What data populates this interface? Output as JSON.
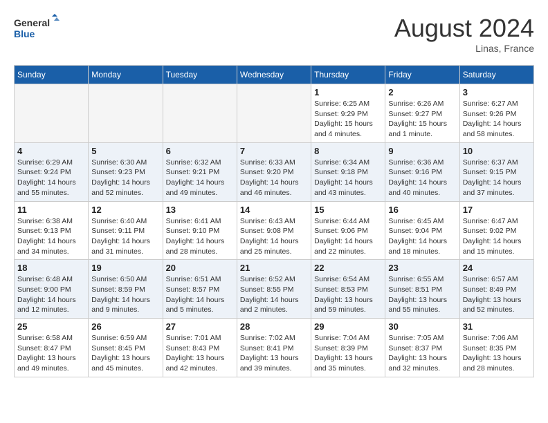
{
  "header": {
    "logo_line1": "General",
    "logo_line2": "Blue",
    "month_year": "August 2024",
    "location": "Linas, France"
  },
  "weekdays": [
    "Sunday",
    "Monday",
    "Tuesday",
    "Wednesday",
    "Thursday",
    "Friday",
    "Saturday"
  ],
  "weeks": [
    [
      {
        "day": "",
        "info": ""
      },
      {
        "day": "",
        "info": ""
      },
      {
        "day": "",
        "info": ""
      },
      {
        "day": "",
        "info": ""
      },
      {
        "day": "1",
        "info": "Sunrise: 6:25 AM\nSunset: 9:29 PM\nDaylight: 15 hours\nand 4 minutes."
      },
      {
        "day": "2",
        "info": "Sunrise: 6:26 AM\nSunset: 9:27 PM\nDaylight: 15 hours\nand 1 minute."
      },
      {
        "day": "3",
        "info": "Sunrise: 6:27 AM\nSunset: 9:26 PM\nDaylight: 14 hours\nand 58 minutes."
      }
    ],
    [
      {
        "day": "4",
        "info": "Sunrise: 6:29 AM\nSunset: 9:24 PM\nDaylight: 14 hours\nand 55 minutes."
      },
      {
        "day": "5",
        "info": "Sunrise: 6:30 AM\nSunset: 9:23 PM\nDaylight: 14 hours\nand 52 minutes."
      },
      {
        "day": "6",
        "info": "Sunrise: 6:32 AM\nSunset: 9:21 PM\nDaylight: 14 hours\nand 49 minutes."
      },
      {
        "day": "7",
        "info": "Sunrise: 6:33 AM\nSunset: 9:20 PM\nDaylight: 14 hours\nand 46 minutes."
      },
      {
        "day": "8",
        "info": "Sunrise: 6:34 AM\nSunset: 9:18 PM\nDaylight: 14 hours\nand 43 minutes."
      },
      {
        "day": "9",
        "info": "Sunrise: 6:36 AM\nSunset: 9:16 PM\nDaylight: 14 hours\nand 40 minutes."
      },
      {
        "day": "10",
        "info": "Sunrise: 6:37 AM\nSunset: 9:15 PM\nDaylight: 14 hours\nand 37 minutes."
      }
    ],
    [
      {
        "day": "11",
        "info": "Sunrise: 6:38 AM\nSunset: 9:13 PM\nDaylight: 14 hours\nand 34 minutes."
      },
      {
        "day": "12",
        "info": "Sunrise: 6:40 AM\nSunset: 9:11 PM\nDaylight: 14 hours\nand 31 minutes."
      },
      {
        "day": "13",
        "info": "Sunrise: 6:41 AM\nSunset: 9:10 PM\nDaylight: 14 hours\nand 28 minutes."
      },
      {
        "day": "14",
        "info": "Sunrise: 6:43 AM\nSunset: 9:08 PM\nDaylight: 14 hours\nand 25 minutes."
      },
      {
        "day": "15",
        "info": "Sunrise: 6:44 AM\nSunset: 9:06 PM\nDaylight: 14 hours\nand 22 minutes."
      },
      {
        "day": "16",
        "info": "Sunrise: 6:45 AM\nSunset: 9:04 PM\nDaylight: 14 hours\nand 18 minutes."
      },
      {
        "day": "17",
        "info": "Sunrise: 6:47 AM\nSunset: 9:02 PM\nDaylight: 14 hours\nand 15 minutes."
      }
    ],
    [
      {
        "day": "18",
        "info": "Sunrise: 6:48 AM\nSunset: 9:00 PM\nDaylight: 14 hours\nand 12 minutes."
      },
      {
        "day": "19",
        "info": "Sunrise: 6:50 AM\nSunset: 8:59 PM\nDaylight: 14 hours\nand 9 minutes."
      },
      {
        "day": "20",
        "info": "Sunrise: 6:51 AM\nSunset: 8:57 PM\nDaylight: 14 hours\nand 5 minutes."
      },
      {
        "day": "21",
        "info": "Sunrise: 6:52 AM\nSunset: 8:55 PM\nDaylight: 14 hours\nand 2 minutes."
      },
      {
        "day": "22",
        "info": "Sunrise: 6:54 AM\nSunset: 8:53 PM\nDaylight: 13 hours\nand 59 minutes."
      },
      {
        "day": "23",
        "info": "Sunrise: 6:55 AM\nSunset: 8:51 PM\nDaylight: 13 hours\nand 55 minutes."
      },
      {
        "day": "24",
        "info": "Sunrise: 6:57 AM\nSunset: 8:49 PM\nDaylight: 13 hours\nand 52 minutes."
      }
    ],
    [
      {
        "day": "25",
        "info": "Sunrise: 6:58 AM\nSunset: 8:47 PM\nDaylight: 13 hours\nand 49 minutes."
      },
      {
        "day": "26",
        "info": "Sunrise: 6:59 AM\nSunset: 8:45 PM\nDaylight: 13 hours\nand 45 minutes."
      },
      {
        "day": "27",
        "info": "Sunrise: 7:01 AM\nSunset: 8:43 PM\nDaylight: 13 hours\nand 42 minutes."
      },
      {
        "day": "28",
        "info": "Sunrise: 7:02 AM\nSunset: 8:41 PM\nDaylight: 13 hours\nand 39 minutes."
      },
      {
        "day": "29",
        "info": "Sunrise: 7:04 AM\nSunset: 8:39 PM\nDaylight: 13 hours\nand 35 minutes."
      },
      {
        "day": "30",
        "info": "Sunrise: 7:05 AM\nSunset: 8:37 PM\nDaylight: 13 hours\nand 32 minutes."
      },
      {
        "day": "31",
        "info": "Sunrise: 7:06 AM\nSunset: 8:35 PM\nDaylight: 13 hours\nand 28 minutes."
      }
    ]
  ]
}
